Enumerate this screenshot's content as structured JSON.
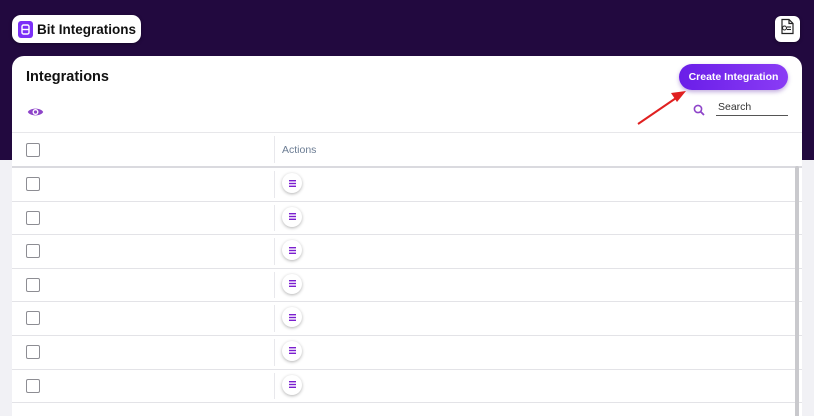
{
  "header": {
    "brand_name": "Bit Integrations",
    "brand_logo_icon": "bit-integrations-logo",
    "docs_icon": "document-icon"
  },
  "page": {
    "title": "Integrations",
    "create_button_label": "Create Integration",
    "view_icon": "eye-icon"
  },
  "search": {
    "placeholder": "Search",
    "value": "",
    "icon": "search-icon"
  },
  "table": {
    "columns": [
      "",
      "Actions"
    ],
    "rows": [
      {
        "action_icon": "menu-icon"
      },
      {
        "action_icon": "menu-icon"
      },
      {
        "action_icon": "menu-icon"
      },
      {
        "action_icon": "menu-icon"
      },
      {
        "action_icon": "menu-icon"
      },
      {
        "action_icon": "menu-icon"
      },
      {
        "action_icon": "menu-icon"
      }
    ]
  },
  "colors": {
    "header_bg": "#22093f",
    "accent": "#7b2ff7",
    "annotation_arrow": "#e02020"
  }
}
